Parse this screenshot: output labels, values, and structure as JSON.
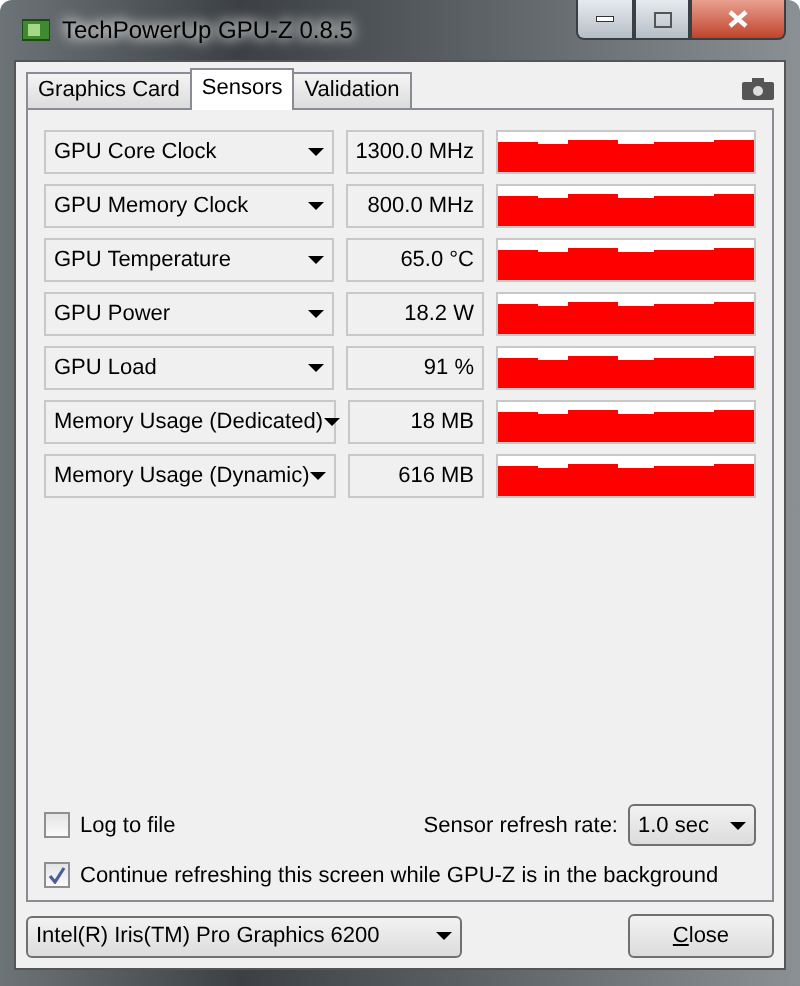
{
  "window": {
    "title": "TechPowerUp GPU-Z 0.8.5"
  },
  "tabs": [
    {
      "label": "Graphics Card",
      "selected": false
    },
    {
      "label": "Sensors",
      "selected": true
    },
    {
      "label": "Validation",
      "selected": false
    }
  ],
  "sensors": [
    {
      "name": "GPU Core Clock",
      "reading": "1300.0 MHz"
    },
    {
      "name": "GPU Memory Clock",
      "reading": "800.0 MHz"
    },
    {
      "name": "GPU Temperature",
      "reading": "65.0 °C"
    },
    {
      "name": "GPU Power",
      "reading": "18.2 W"
    },
    {
      "name": "GPU Load",
      "reading": "91 %"
    },
    {
      "name": "Memory Usage (Dedicated)",
      "reading": "18 MB"
    },
    {
      "name": "Memory Usage (Dynamic)",
      "reading": "616 MB"
    }
  ],
  "log_to_file": {
    "label": "Log to file",
    "checked": false
  },
  "refresh_rate": {
    "label": "Sensor refresh rate:",
    "value": "1.0 sec"
  },
  "continue_refreshing": {
    "label": "Continue refreshing this screen while GPU-Z is in the background",
    "checked": true
  },
  "gpu_select": {
    "value": "Intel(R) Iris(TM) Pro Graphics 6200"
  },
  "close_button": "Close"
}
